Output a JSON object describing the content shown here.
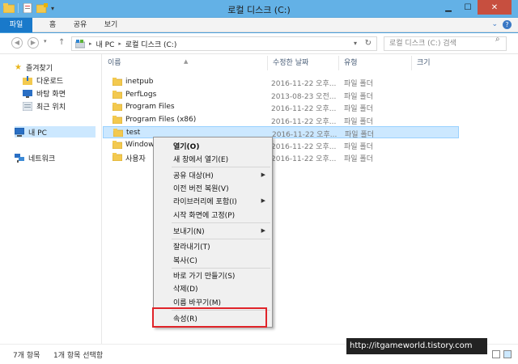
{
  "window": {
    "title": "로컬 디스크 (C:)"
  },
  "ribbon": {
    "tabs": [
      "파일",
      "홈",
      "공유",
      "보기"
    ]
  },
  "address": {
    "crumbs": [
      "내 PC",
      "로컬 디스크 (C:)"
    ],
    "sep": "▸"
  },
  "search": {
    "placeholder": "로컬 디스크 (C:) 검색"
  },
  "navpane": {
    "favorites": "즐겨찾기",
    "fav_items": [
      "다운로드",
      "바탕 화면",
      "최근 위치"
    ],
    "pc": "내 PC",
    "network": "네트워크"
  },
  "columns": {
    "name": "이름",
    "date": "수정한 날짜",
    "type": "유형",
    "size": "크기"
  },
  "rows": [
    {
      "name": "inetpub",
      "date": "2016-11-22 오후...",
      "type": "파일 폴더"
    },
    {
      "name": "PerfLogs",
      "date": "2013-08-23 오전...",
      "type": "파일 폴더"
    },
    {
      "name": "Program Files",
      "date": "2016-11-22 오후...",
      "type": "파일 폴더"
    },
    {
      "name": "Program Files (x86)",
      "date": "2016-11-22 오후...",
      "type": "파일 폴더"
    },
    {
      "name": "test",
      "date": "2016-11-22 오후...",
      "type": "파일 폴더"
    },
    {
      "name": "Window",
      "date": "2016-11-22 오후...",
      "type": "파일 폴더"
    },
    {
      "name": "사용자",
      "date": "2016-11-22 오후...",
      "type": "파일 폴더"
    }
  ],
  "menu": {
    "open": "열기(O)",
    "open_new": "새 창에서 열기(E)",
    "share": "공유 대상(H)",
    "restore": "이전 버전 복원(V)",
    "library": "라이브러리에 포함(I)",
    "pin": "시작 화면에 고정(P)",
    "send": "보내기(N)",
    "cut": "잘라내기(T)",
    "copy": "복사(C)",
    "shortcut": "바로 가기 만들기(S)",
    "delete": "삭제(D)",
    "rename": "이름 바꾸기(M)",
    "properties": "속성(R)"
  },
  "status": {
    "count": "7개 항목",
    "selected": "1개 항목 선택함"
  },
  "watermark": "http://itgameworld.tistory.com",
  "colors": {
    "accent": "#1979ca",
    "highlight": "#e0242a",
    "selection": "#cce8ff"
  }
}
